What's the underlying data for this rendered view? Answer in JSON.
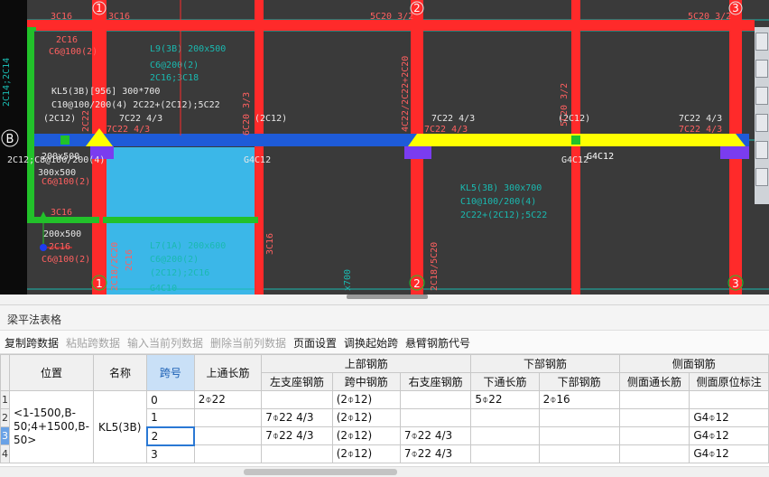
{
  "cad": {
    "axis_top": [
      "1",
      "2",
      "3"
    ],
    "axis_bottom": [
      "1",
      "2",
      "3"
    ],
    "axis_left": "B",
    "labels": {
      "t_3c16_a": "3C16",
      "t_3c16_b": "3C16",
      "t_5c20_a": "5C20 3/2",
      "t_5c20_b": "5C20 3/2",
      "t_2c16": "2C16",
      "t_c6_a": "C6@100(2)",
      "t_l9_1": "L9(3B) 200x500",
      "t_l9_2": "C6@200(2)",
      "t_l9_3": "2C16;3C18",
      "t_kl5_1": "KL5(3B)[956] 300*700",
      "t_kl5_2": "C10@100/200(4) 2C22+(2C12);5C22",
      "t_2c12": "(2C12)",
      "t_7c22_a": "7C22 4/3",
      "t_7c22_b": "7C22 4/3",
      "t_7c22_c": "7C22 4/3",
      "t_7c22_d": "7C22 4/3",
      "t_7c22_e": "7C22 4/3",
      "t_7c22_f": "7C22 4/3",
      "t_2c12_b": "(2C12)",
      "t_2c12_c": "(2C12)",
      "t_g4_a": "G4C12",
      "t_g4_b": "G4C12",
      "t_g4_c": "G4C12",
      "t_kl5b_1": "KL5(3B) 300x700",
      "t_kl5b_2": "C10@100/200(4)",
      "t_kl5b_3": "2C22+(2C12);5C22",
      "t_200x500": "200x500",
      "t_c6_b": "C6@100(2)",
      "t_c6_c": "C6@100(2)",
      "t_3c16_c": "3C16",
      "t_200x500_b": "200x500",
      "t_2c16_b": "2C16",
      "t_c6_d": "C6@100(2)",
      "t_l7_1": "L7(1A) 200x600",
      "t_l7_2": "C6@200(2)",
      "t_l7_3": "(2C12);2C16",
      "t_g4_d": "G4C10",
      "t_3c16_d": "3C16",
      "t_left_v": "2C14;2C14",
      "t_v1": "6C20 3/3",
      "t_v2": "4C22/2C22+2C20",
      "t_v3": "5C20 3/2",
      "t_v4": "2C18/5C20",
      "t_v5": "2C18/2C20",
      "t_v6": "2C16",
      "t_v7": "2C22",
      "t_v8": "x700",
      "t_2c14": "2C14",
      "t_c8": "2C12;C8@100/200(4)",
      "t_300": "300x500"
    },
    "colors": {
      "background": "#3a3a3a",
      "column_beam": "#ff2a2a",
      "selected_beam": "#1e5bd8",
      "highlight_span": "#ffff00",
      "green_beam": "#22c12a",
      "slab_blue": "#3bb7e8",
      "purple_node": "#7a3cf0",
      "text_red": "#ff6060",
      "text_cyan": "#1ab9b0",
      "text_white": "#e8e8e8"
    }
  },
  "panel": {
    "title": "梁平法表格"
  },
  "toolbar": {
    "copy_span": "复制跨数据",
    "paste_span": "粘贴跨数据",
    "input_col": "输入当前列数据",
    "delete_col": "删除当前列数据",
    "page_setup": "页面设置",
    "swap_start": "调换起始跨",
    "cantilever": "悬臂钢筋代号"
  },
  "table": {
    "headers": {
      "pos": "位置",
      "name": "名称",
      "span": "跨号",
      "top_cont": "上通长筋",
      "top_group": "上部钢筋",
      "bot_group": "下部钢筋",
      "side_group": "侧面钢筋",
      "left_seat": "左支座钢筋",
      "mid_span": "跨中钢筋",
      "right_seat": "右支座钢筋",
      "bot_cont": "下通长筋",
      "bot_rebar": "下部钢筋",
      "side_cont": "侧面通长筋",
      "side_orig": "侧面原位标注"
    },
    "position": "<1-1500,B-50;4+1500,B-50>",
    "beam_name": "KL5(3B)",
    "row_numbers": [
      "1",
      "2",
      "3",
      "4"
    ],
    "rows": [
      {
        "span": "0",
        "top_cont": "2⌽22",
        "left": "",
        "mid": "(2⌽12)",
        "right": "",
        "bot_cont": "5⌽22",
        "bot": "2⌽16",
        "side_cont": "",
        "side_orig": ""
      },
      {
        "span": "1",
        "top_cont": "",
        "left": "7⌽22 4/3",
        "mid": "(2⌽12)",
        "right": "",
        "bot_cont": "",
        "bot": "",
        "side_cont": "",
        "side_orig": "G4⌽12"
      },
      {
        "span": "2",
        "top_cont": "",
        "left": "7⌽22 4/3",
        "mid": "(2⌽12)",
        "right": "7⌽22 4/3",
        "bot_cont": "",
        "bot": "",
        "side_cont": "",
        "side_orig": "G4⌽12"
      },
      {
        "span": "3",
        "top_cont": "",
        "left": "",
        "mid": "(2⌽12)",
        "right": "7⌽22 4/3",
        "bot_cont": "",
        "bot": "",
        "side_cont": "",
        "side_orig": "G4⌽12"
      }
    ]
  }
}
